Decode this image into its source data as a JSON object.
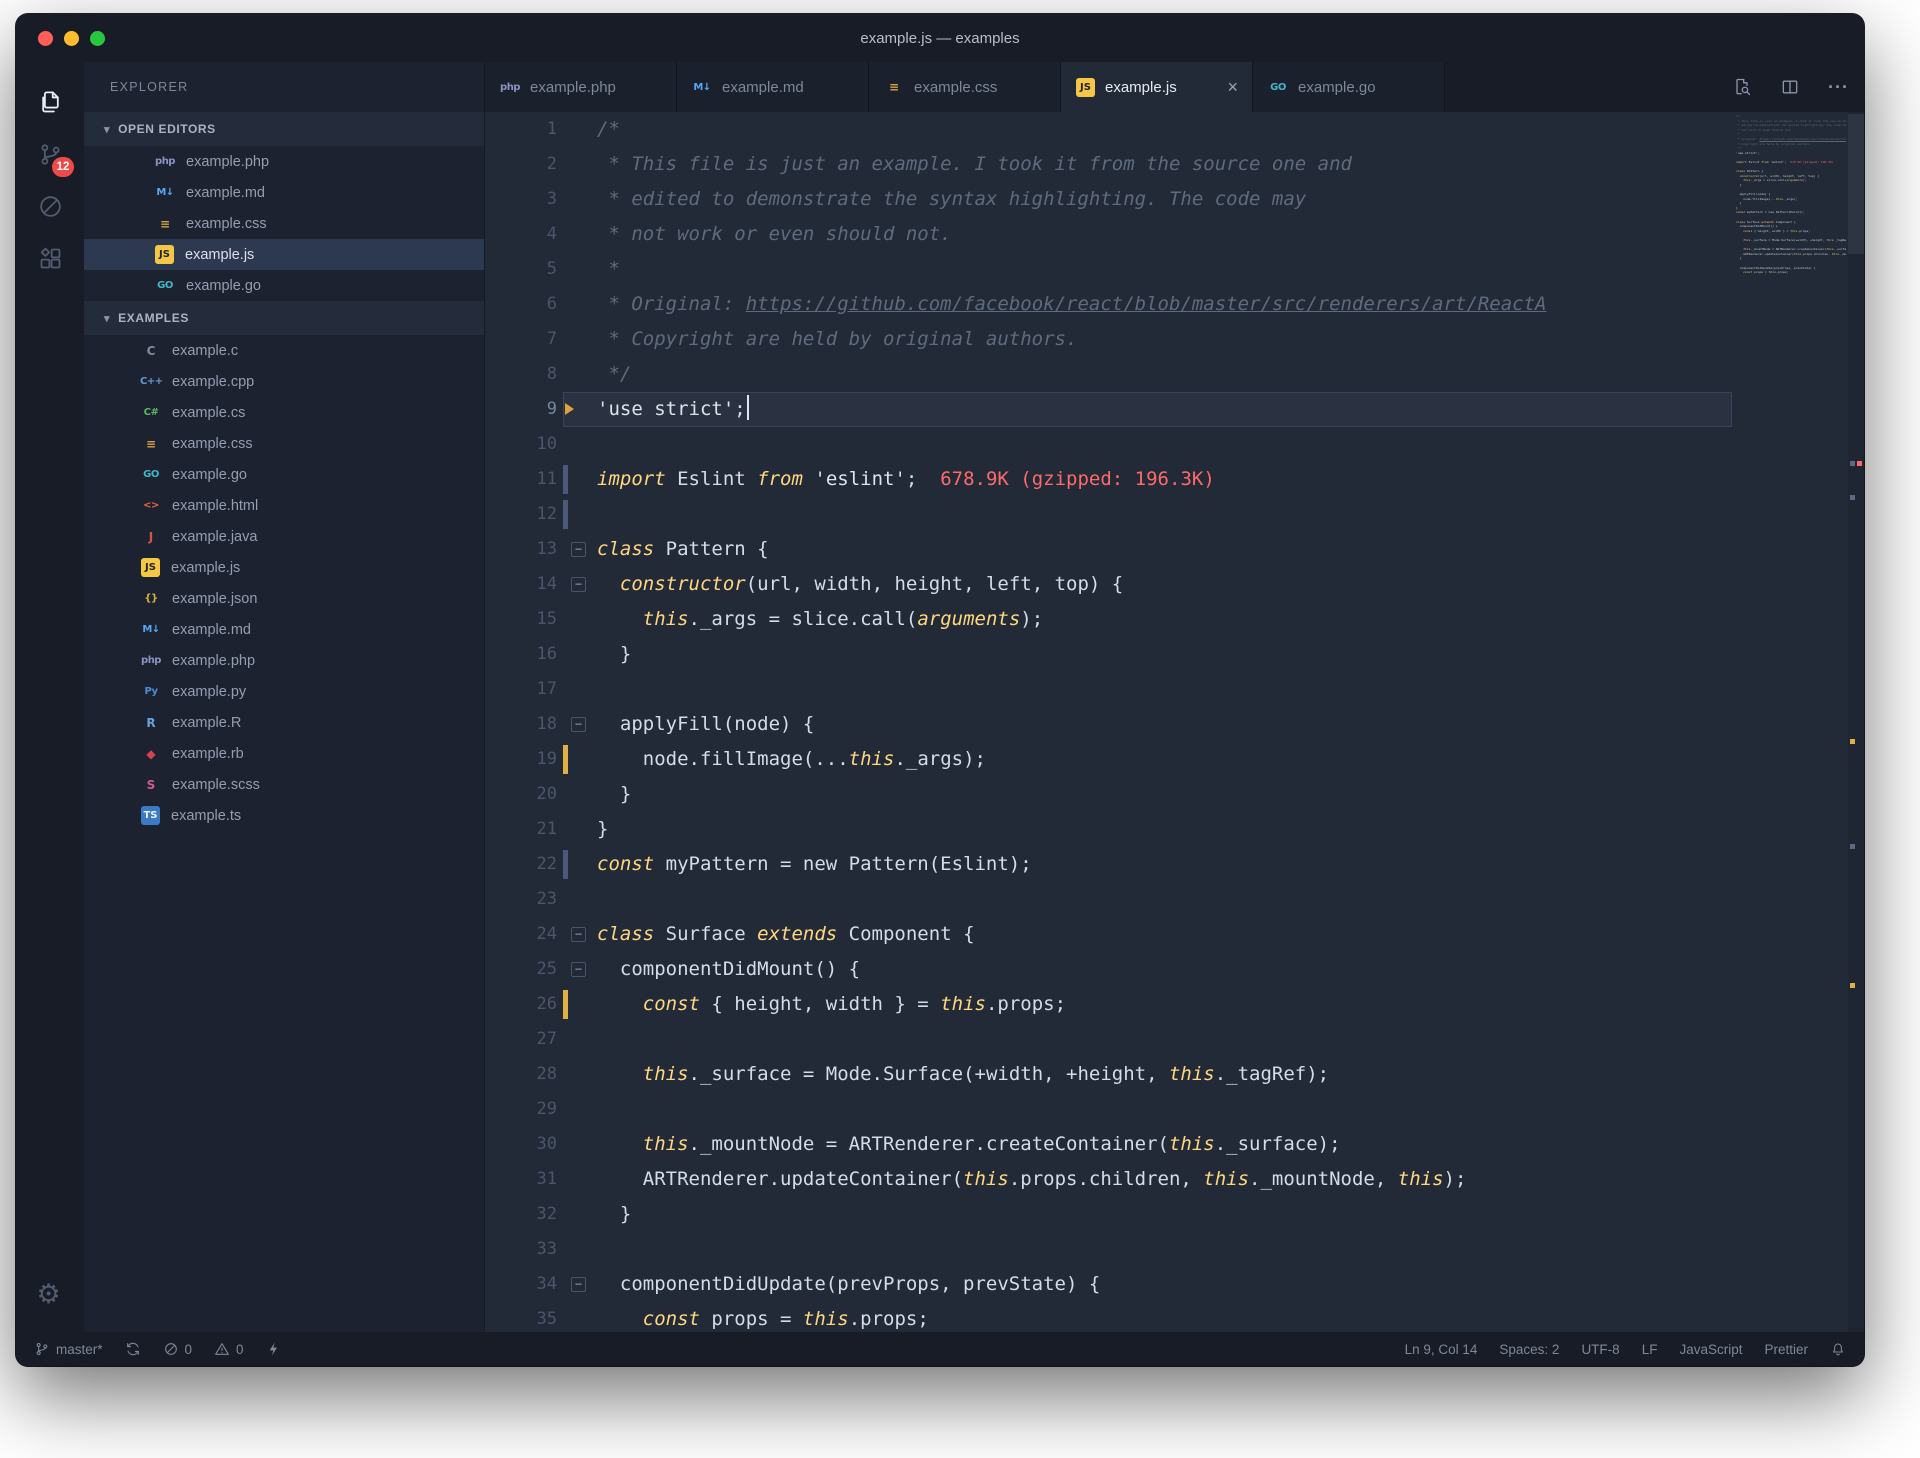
{
  "window_title": "example.js — examples",
  "titlebar": {
    "traffic_lights": [
      {
        "name": "close",
        "color": "#ff5f57"
      },
      {
        "name": "minimize",
        "color": "#febc2e"
      },
      {
        "name": "zoom",
        "color": "#29c73f"
      }
    ]
  },
  "colors": {
    "editor_bg": "#232a37",
    "chrome_bg": "#171c26",
    "sidebar_bg": "#1c2230",
    "badge_red": "#ef4a4a",
    "keyword_yellow": "#ffd780",
    "comment_gray": "#5e6b7e",
    "import_cost_red": "#fc6a6a",
    "git_modified_orange": "#dfb045",
    "git_modified_slate": "#4d5a77"
  },
  "activity_bar": {
    "items": [
      {
        "name": "explorer",
        "icon": "files-icon",
        "active": true
      },
      {
        "name": "source-control",
        "icon": "git-branch-icon",
        "badge": "12"
      },
      {
        "name": "debug",
        "icon": "circle-slash-icon"
      },
      {
        "name": "extensions",
        "icon": "extensions-icon"
      }
    ],
    "bottom": [
      {
        "name": "settings",
        "icon": "gear-icon"
      }
    ]
  },
  "file_icons": {
    "php": {
      "label": "php",
      "color": "#8a93c4",
      "small": true
    },
    "md": {
      "label": "M↓",
      "color": "#56a8f5",
      "small": true
    },
    "css": {
      "label": "≡",
      "color": "#d8a23c"
    },
    "js": {
      "label": "JS",
      "color": "#1d2330",
      "bg": "#f5c744"
    },
    "go": {
      "label": "GO",
      "color": "#43b7c2",
      "small": true
    },
    "c": {
      "label": "C",
      "color": "#7d8ba3"
    },
    "cpp": {
      "label": "C++",
      "color": "#649ad1",
      "small": true
    },
    "cs": {
      "label": "C#",
      "color": "#5fb365",
      "small": true
    },
    "html": {
      "label": "<>",
      "color": "#e5663e",
      "small": true
    },
    "java": {
      "label": "J",
      "color": "#d65348"
    },
    "json": {
      "label": "{}",
      "color": "#d9b33e",
      "small": true
    },
    "py": {
      "label": "Py",
      "color": "#4e8fd0",
      "small": true
    },
    "r": {
      "label": "R",
      "color": "#64a4e0"
    },
    "rb": {
      "label": "◆",
      "color": "#d6434e"
    },
    "scss": {
      "label": "S",
      "color": "#d6588f"
    },
    "ts": {
      "label": "TS",
      "color": "#eef2f8",
      "bg": "#3b7bc4"
    }
  },
  "sidebar": {
    "title": "EXPLORER",
    "sections": [
      {
        "label": "OPEN EDITORS",
        "name": "open-editors",
        "indent": "indent1",
        "items": [
          {
            "name": "example.php",
            "type": "php"
          },
          {
            "name": "example.md",
            "type": "md"
          },
          {
            "name": "example.css",
            "type": "css"
          },
          {
            "name": "example.js",
            "type": "js",
            "selected": true
          },
          {
            "name": "example.go",
            "type": "go"
          }
        ]
      },
      {
        "label": "EXAMPLES",
        "name": "examples",
        "indent": "indent0",
        "items": [
          {
            "name": "example.c",
            "type": "c"
          },
          {
            "name": "example.cpp",
            "type": "cpp"
          },
          {
            "name": "example.cs",
            "type": "cs"
          },
          {
            "name": "example.css",
            "type": "css"
          },
          {
            "name": "example.go",
            "type": "go"
          },
          {
            "name": "example.html",
            "type": "html"
          },
          {
            "name": "example.java",
            "type": "java"
          },
          {
            "name": "example.js",
            "type": "js"
          },
          {
            "name": "example.json",
            "type": "json"
          },
          {
            "name": "example.md",
            "type": "md"
          },
          {
            "name": "example.php",
            "type": "php"
          },
          {
            "name": "example.py",
            "type": "py"
          },
          {
            "name": "example.R",
            "type": "r"
          },
          {
            "name": "example.rb",
            "type": "rb"
          },
          {
            "name": "example.scss",
            "type": "scss"
          },
          {
            "name": "example.ts",
            "type": "ts"
          }
        ]
      }
    ]
  },
  "tabs": [
    {
      "label": "example.php",
      "type": "php"
    },
    {
      "label": "example.md",
      "type": "md"
    },
    {
      "label": "example.css",
      "type": "css"
    },
    {
      "label": "example.js",
      "type": "js",
      "active": true
    },
    {
      "label": "example.go",
      "type": "go"
    }
  ],
  "editor_actions": [
    {
      "name": "open-changes",
      "icon": "search-file-icon"
    },
    {
      "name": "split-editor",
      "icon": "split-icon"
    },
    {
      "name": "more-actions",
      "icon": "ellipsis-icon"
    }
  ],
  "editor": {
    "lines": [
      {
        "seg": [
          [
            "c",
            "/*"
          ]
        ]
      },
      {
        "seg": [
          [
            "c",
            " * This file is just an example. I took it from the source one and"
          ]
        ]
      },
      {
        "seg": [
          [
            "c",
            " * edited to demonstrate the syntax highlighting. The code may"
          ]
        ]
      },
      {
        "seg": [
          [
            "c",
            " * not work or even should not."
          ]
        ]
      },
      {
        "seg": [
          [
            "c",
            " *"
          ]
        ]
      },
      {
        "seg": [
          [
            "c",
            " * Original: "
          ],
          [
            "l",
            "https://github.com/facebook/react/blob/master/src/renderers/art/ReactA"
          ]
        ]
      },
      {
        "seg": [
          [
            "c",
            " * Copyright are held by original authors."
          ]
        ]
      },
      {
        "seg": [
          [
            "c",
            " */"
          ]
        ]
      },
      {
        "current": true,
        "cursor": true,
        "seg": [
          [
            "s",
            "'use strict'"
          ],
          [
            "p",
            ";"
          ]
        ]
      },
      {
        "seg": []
      },
      {
        "marker": "slate",
        "seg": [
          [
            "k",
            "import"
          ],
          [
            "p",
            " Eslint "
          ],
          [
            "k",
            "from"
          ],
          [
            "p",
            " "
          ],
          [
            "s",
            "'eslint'"
          ],
          [
            "p",
            ";"
          ],
          [
            "r",
            "  678.9K (gzipped: 196.3K)"
          ]
        ]
      },
      {
        "marker": "slate",
        "seg": []
      },
      {
        "fold": true,
        "seg": [
          [
            "k",
            "class"
          ],
          [
            "p",
            " Pattern {"
          ]
        ]
      },
      {
        "fold": true,
        "seg": [
          [
            "p",
            "  "
          ],
          [
            "k",
            "constructor"
          ],
          [
            "p",
            "(url, width, height, left, top) {"
          ]
        ]
      },
      {
        "seg": [
          [
            "p",
            "    "
          ],
          [
            "k",
            "this"
          ],
          [
            "p",
            "._args = slice.call("
          ],
          [
            "k",
            "arguments"
          ],
          [
            "p",
            ");"
          ]
        ]
      },
      {
        "seg": [
          [
            "p",
            "  }"
          ]
        ]
      },
      {
        "seg": []
      },
      {
        "fold": true,
        "seg": [
          [
            "p",
            "  applyFill(node) {"
          ]
        ]
      },
      {
        "marker": "orange",
        "seg": [
          [
            "p",
            "    node.fillImage(..."
          ],
          [
            "k",
            "this"
          ],
          [
            "p",
            "._args);"
          ]
        ]
      },
      {
        "seg": [
          [
            "p",
            "  }"
          ]
        ]
      },
      {
        "seg": [
          [
            "p",
            "}"
          ]
        ]
      },
      {
        "marker": "slate",
        "seg": [
          [
            "k",
            "const"
          ],
          [
            "p",
            " myPattern = new Pattern(Eslint);"
          ]
        ]
      },
      {
        "seg": []
      },
      {
        "fold": true,
        "seg": [
          [
            "k",
            "class"
          ],
          [
            "p",
            " Surface "
          ],
          [
            "k",
            "extends"
          ],
          [
            "p",
            " Component {"
          ]
        ]
      },
      {
        "fold": true,
        "seg": [
          [
            "p",
            "  componentDidMount() {"
          ]
        ]
      },
      {
        "marker": "orange",
        "seg": [
          [
            "p",
            "    "
          ],
          [
            "k",
            "const"
          ],
          [
            "p",
            " { height, width } = "
          ],
          [
            "k",
            "this"
          ],
          [
            "p",
            ".props;"
          ]
        ]
      },
      {
        "seg": []
      },
      {
        "seg": [
          [
            "p",
            "    "
          ],
          [
            "k",
            "this"
          ],
          [
            "p",
            "._surface = Mode.Surface(+width, +height, "
          ],
          [
            "k",
            "this"
          ],
          [
            "p",
            "._tagRef);"
          ]
        ]
      },
      {
        "seg": []
      },
      {
        "seg": [
          [
            "p",
            "    "
          ],
          [
            "k",
            "this"
          ],
          [
            "p",
            "._mountNode = ARTRenderer.createContainer("
          ],
          [
            "k",
            "this"
          ],
          [
            "p",
            "._surface);"
          ]
        ]
      },
      {
        "seg": [
          [
            "p",
            "    ARTRenderer.updateContainer("
          ],
          [
            "k",
            "this"
          ],
          [
            "p",
            ".props.children, "
          ],
          [
            "k",
            "this"
          ],
          [
            "p",
            "._mountNode, "
          ],
          [
            "k",
            "this"
          ],
          [
            "p",
            ");"
          ]
        ]
      },
      {
        "seg": [
          [
            "p",
            "  }"
          ]
        ]
      },
      {
        "seg": []
      },
      {
        "fold": true,
        "seg": [
          [
            "p",
            "  componentDidUpdate(prevProps, prevState) {"
          ]
        ]
      },
      {
        "seg": [
          [
            "p",
            "    "
          ],
          [
            "k",
            "const"
          ],
          [
            "p",
            " props = "
          ],
          [
            "k",
            "this"
          ],
          [
            "p",
            ".props;"
          ]
        ]
      }
    ]
  },
  "status_bar": {
    "left": [
      {
        "name": "git-branch",
        "icon": "git-branch-icon",
        "label": "master*"
      },
      {
        "name": "sync",
        "icon": "sync-icon",
        "label": ""
      },
      {
        "name": "errors",
        "icon": "error-icon",
        "label": "0"
      },
      {
        "name": "warnings",
        "icon": "warning-icon",
        "label": "0"
      },
      {
        "name": "feedback",
        "icon": "bolt-icon",
        "label": ""
      }
    ],
    "right": [
      {
        "name": "cursor-position",
        "label": "Ln 9, Col 14"
      },
      {
        "name": "indentation",
        "label": "Spaces: 2"
      },
      {
        "name": "encoding",
        "label": "UTF-8"
      },
      {
        "name": "eol",
        "label": "LF"
      },
      {
        "name": "language-mode",
        "label": "JavaScript"
      },
      {
        "name": "formatter",
        "label": "Prettier"
      },
      {
        "name": "notifications",
        "icon": "bell-icon",
        "label": ""
      }
    ]
  }
}
